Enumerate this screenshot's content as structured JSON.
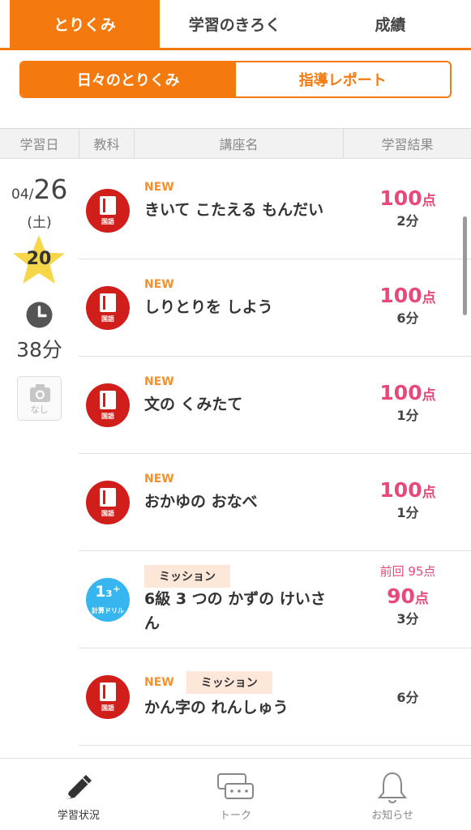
{
  "top_tabs": [
    {
      "label": "とりくみ",
      "active": true
    },
    {
      "label": "学習のきろく",
      "active": false
    },
    {
      "label": "成績",
      "active": false
    }
  ],
  "segments": [
    {
      "label": "日々のとりくみ",
      "active": true
    },
    {
      "label": "指導レポート",
      "active": false
    }
  ],
  "table_header": [
    "学習日",
    "教科",
    "講座名",
    "学習結果"
  ],
  "day": {
    "month": "04/",
    "day": "26",
    "weekday": "(土)",
    "stars": "20",
    "duration": "38分",
    "photo_label": "なし"
  },
  "rows": [
    {
      "subject": "国語",
      "icon": "kokugo-book-icon",
      "new": "NEW",
      "mission": "",
      "title": "きいて こたえる もんだい",
      "prev": "",
      "score": "100",
      "unit": "点",
      "time": "2分"
    },
    {
      "subject": "国語",
      "icon": "kokugo-book-icon",
      "new": "NEW",
      "mission": "",
      "title": "しりとりを しよう",
      "prev": "",
      "score": "100",
      "unit": "点",
      "time": "6分"
    },
    {
      "subject": "国語",
      "icon": "kokugo-book-icon",
      "new": "NEW",
      "mission": "",
      "title": "文の くみたて",
      "prev": "",
      "score": "100",
      "unit": "点",
      "time": "1分"
    },
    {
      "subject": "国語",
      "icon": "kokugo-book-icon",
      "new": "NEW",
      "mission": "",
      "title": "おかゆの おなべ",
      "prev": "",
      "score": "100",
      "unit": "点",
      "time": "1分"
    },
    {
      "subject": "計算ドリル",
      "icon": "calc-drill-icon",
      "drill_num": "1₃⁺",
      "new": "",
      "mission": "ミッション",
      "title": "6級 3 つの かずの けいさん",
      "prev": "前回 95点",
      "score": "90",
      "unit": "点",
      "time": "3分"
    },
    {
      "subject": "国語",
      "icon": "kokugo-book-icon",
      "new": "NEW",
      "mission": "ミッション",
      "title": "かん字の れんしゅう",
      "prev": "",
      "score": "",
      "unit": "",
      "time": "6分"
    }
  ],
  "bottom_nav": [
    {
      "label": "学習状況",
      "icon": "pencil-icon",
      "active": true
    },
    {
      "label": "トーク",
      "icon": "chat-icon",
      "active": false
    },
    {
      "label": "お知らせ",
      "icon": "bell-icon",
      "active": false
    }
  ],
  "colors": {
    "accent": "#f47a0f",
    "score": "#e8497a",
    "kokugo": "#d01f1a",
    "drill": "#36b5ef",
    "star": "#f7d74a"
  }
}
